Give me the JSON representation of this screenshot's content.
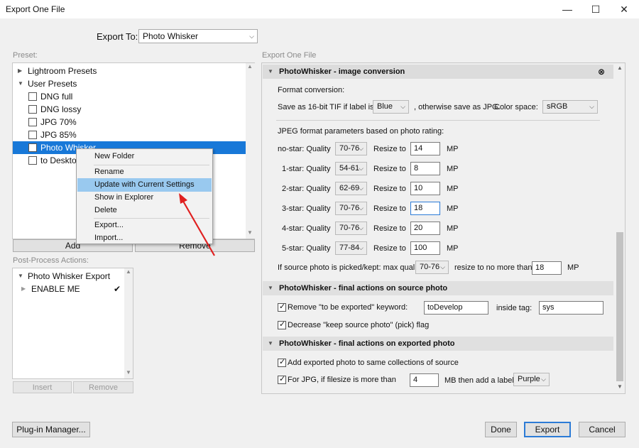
{
  "window": {
    "title": "Export One File",
    "minimize": "—",
    "maximize": "☐",
    "close": "✕"
  },
  "export_to": {
    "label": "Export To:",
    "value": "Photo Whisker"
  },
  "preset": {
    "label": "Preset:",
    "groups": [
      {
        "label": "Lightroom Presets"
      },
      {
        "label": "User Presets"
      }
    ],
    "items": [
      {
        "label": "DNG full"
      },
      {
        "label": "DNG lossy"
      },
      {
        "label": "JPG 70%"
      },
      {
        "label": "JPG 85%"
      },
      {
        "label": "Photo Whisker"
      },
      {
        "label": "to Desktop"
      }
    ],
    "add_label": "Add",
    "remove_label": "Remove"
  },
  "context_menu": {
    "items": [
      "New Folder",
      "Rename",
      "Update with Current Settings",
      "Show in Explorer",
      "Delete",
      "Export...",
      "Import..."
    ]
  },
  "post_process": {
    "label": "Post-Process Actions:",
    "group": "Photo Whisker Export",
    "action": "ENABLE ME",
    "action_check": "✔",
    "insert_label": "Insert",
    "remove_label": "Remove"
  },
  "right_panel_label": "Export One File",
  "image_conversion": {
    "title": "PhotoWhisker - image conversion",
    "close_icon": "⊗",
    "format_conversion": "Format conversion:",
    "save_tif_label": "Save as 16-bit TIF if label is",
    "tif_label_value": "Blue",
    "otherwise_text": ", otherwise save as JPG.",
    "color_space_label": "Color space:",
    "color_space_value": "sRGB",
    "jpeg_params_label": "JPEG format parameters based on photo rating:",
    "resize_label": "Resize to",
    "mp_label": "MP",
    "ratings": [
      {
        "label": "no-star: Quality",
        "quality": "70-76",
        "resize": "14"
      },
      {
        "label": "1-star: Quality",
        "quality": "54-61",
        "resize": "8"
      },
      {
        "label": "2-star: Quality",
        "quality": "62-69",
        "resize": "10"
      },
      {
        "label": "3-star: Quality",
        "quality": "70-76",
        "resize": "18"
      },
      {
        "label": "4-star: Quality",
        "quality": "70-76",
        "resize": "20"
      },
      {
        "label": "5-star: Quality",
        "quality": "77-84",
        "resize": "100"
      }
    ],
    "picked_label": "If source photo is picked/kept: max quality",
    "picked_quality": "70-76",
    "resize_no_more_label": "resize to no more than",
    "picked_resize": "18",
    "picked_mp": "MP"
  },
  "source_actions": {
    "title": "PhotoWhisker - final actions on source photo",
    "remove_keyword_label": "Remove \"to be exported\" keyword:",
    "keyword_value": "toDevelop",
    "inside_tag_label": "inside tag:",
    "tag_value": "sys",
    "decrease_flag_label": "Decrease \"keep source photo\" (pick) flag"
  },
  "exported_actions": {
    "title": "PhotoWhisker - final actions on exported photo",
    "add_collections_label": "Add exported photo to same collections of source",
    "jpg_filesize_label": "For JPG, if filesize is more than",
    "filesize_value": "4",
    "mb_label": "MB then add a label",
    "label_value": "Purple"
  },
  "footer": {
    "plugin_manager": "Plug-in Manager...",
    "done": "Done",
    "export": "Export",
    "cancel": "Cancel"
  },
  "colors": {
    "selection": "#1878d8",
    "menu_highlight": "#99c9ef",
    "arrow": "#e02020",
    "primary_border": "#2c7bd6"
  }
}
